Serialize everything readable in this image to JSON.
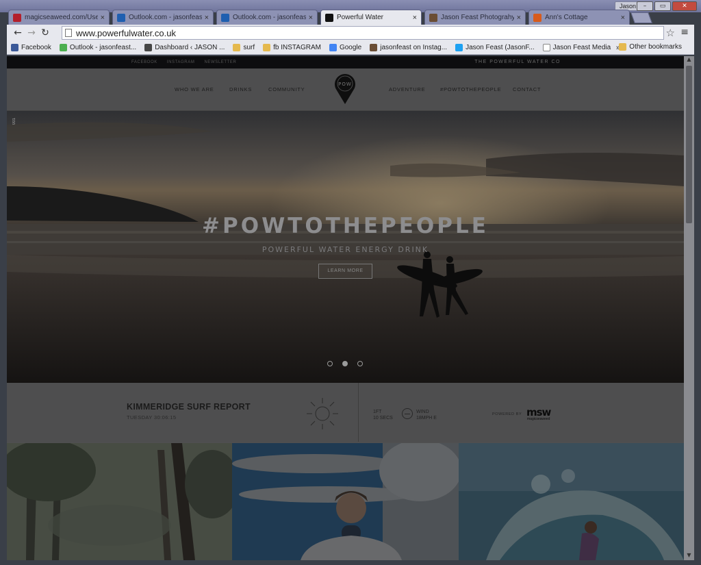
{
  "window": {
    "user_label": "Jason",
    "controls": [
      "–",
      "▭",
      "✕"
    ]
  },
  "tabs": [
    {
      "label": "magicseaweed.com/User",
      "icon": "magicseaweed-icon",
      "color": "#b31f2b",
      "active": false
    },
    {
      "label": "Outlook.com - jasonfeast",
      "icon": "outlook-icon",
      "color": "#1f5fb0",
      "active": false
    },
    {
      "label": "Outlook.com - jasonfeast",
      "icon": "outlook-icon",
      "color": "#1f5fb0",
      "active": false
    },
    {
      "label": "Powerful Water",
      "icon": "map-pin-icon",
      "color": "#111111",
      "active": true
    },
    {
      "label": "Jason Feast Photograhy",
      "icon": "instagram-icon",
      "color": "#6a4d35",
      "active": false
    },
    {
      "label": "Ann's Cottage",
      "icon": "cottage-icon",
      "color": "#d75b1c",
      "active": false
    }
  ],
  "toolbar": {
    "back": "←",
    "forward": "→",
    "reload": "↻",
    "url": "www.powerfulwater.co.uk",
    "star": "☆",
    "menu": "≡"
  },
  "bookmarks": {
    "items": [
      {
        "label": "Facebook",
        "icon": "facebook-icon",
        "color": "#3b5998"
      },
      {
        "label": "Outlook - jasonfeast...",
        "icon": "windows-icon",
        "color": "#4caf50"
      },
      {
        "label": "Dashboard ‹ JASON ...",
        "icon": "wordpress-icon",
        "color": "#464646"
      },
      {
        "label": "surf",
        "icon": "folder-icon",
        "color": "#e5b94e"
      },
      {
        "label": "fb INSTAGRAM",
        "icon": "folder-icon",
        "color": "#e5b94e"
      },
      {
        "label": "Google",
        "icon": "google-icon",
        "color": "#4285f4"
      },
      {
        "label": "jasonfeast on Instag...",
        "icon": "instagram-icon",
        "color": "#6a4d35"
      },
      {
        "label": "Jason Feast (JasonF...",
        "icon": "twitter-icon",
        "color": "#1da1f2"
      },
      {
        "label": "Jason Feast Media",
        "icon": "page-icon",
        "color": "#ffffff"
      }
    ],
    "more": "»",
    "other": "Other bookmarks"
  },
  "site": {
    "top_links": [
      "FACEBOOK",
      "INSTAGRAM",
      "NEWSLETTER"
    ],
    "brand": "THE POWERFUL WATER CO",
    "nav_left": [
      "WHO WE ARE",
      "DRINKS",
      "COMMUNITY"
    ],
    "nav_right": [
      "ADVENTURE",
      "#POWTOTHEPEOPLE",
      "CONTACT"
    ],
    "logo_text": "POW",
    "hero": {
      "slide_number": "001",
      "title": "#POWTOTHEPEOPLE",
      "subtitle": "POWERFUL WATER ENERGY DRINK",
      "button": "LEARN MORE",
      "slides": 3,
      "active_slide": 1
    },
    "surf": {
      "title": "KIMMERIDGE SURF REPORT",
      "date": "TUESDAY 30:06:15",
      "swell_height": "1FT",
      "swell_period": "10 SECS",
      "wind_label": "WIND",
      "wind_value": "18MPH E",
      "powered_by": "POWERED BY",
      "msw_logo": "msw",
      "msw_sub": "magicseaweed"
    }
  }
}
